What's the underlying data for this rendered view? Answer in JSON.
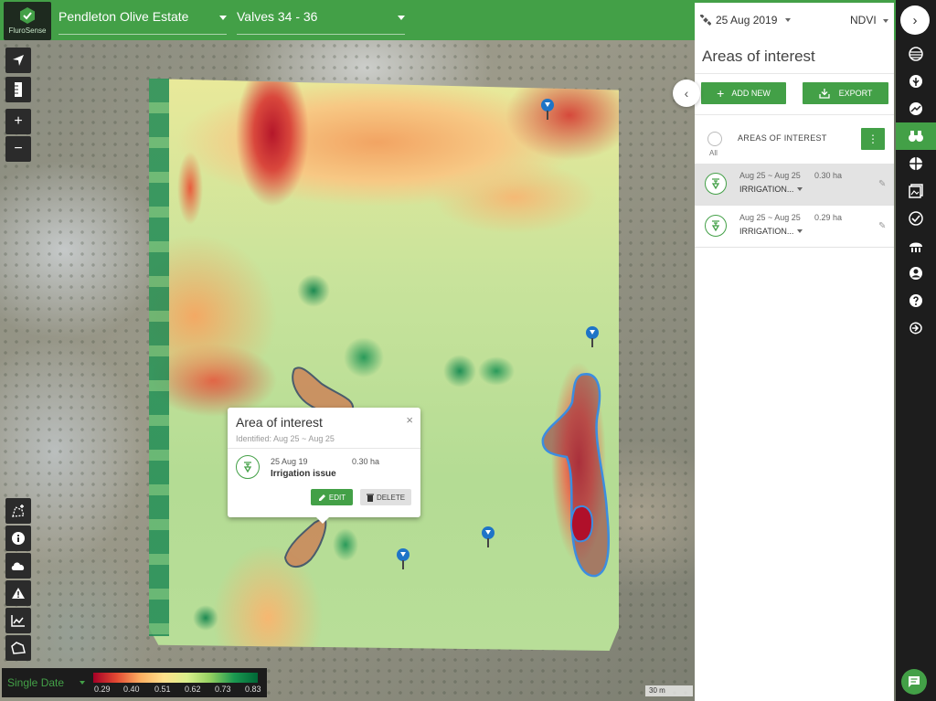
{
  "brand": {
    "logo_text": "FluroSense"
  },
  "topbar": {
    "farm": "Pendleton Olive Estate",
    "field": "Valves 34 - 36"
  },
  "panel": {
    "date": "25 Aug 2019",
    "layer": "NDVI",
    "title": "Areas of interest",
    "add_new_label": "ADD NEW",
    "export_label": "EXPORT",
    "list_header": "AREAS OF INTEREST",
    "select_all_label": "All",
    "items": [
      {
        "dates": "Aug 25 ~ Aug 25",
        "area": "0.30 ha",
        "type": "IRRIGATION...",
        "selected": true
      },
      {
        "dates": "Aug 25 ~ Aug 25",
        "area": "0.29 ha",
        "type": "IRRIGATION...",
        "selected": false
      }
    ]
  },
  "popup": {
    "title": "Area of interest",
    "close": "×",
    "identified": "Identified: Aug 25 ~ Aug 25",
    "date": "25 Aug 19",
    "area": "0.30 ha",
    "issue": "Irrigation issue",
    "edit_label": "EDIT",
    "delete_label": "DELETE"
  },
  "legend": {
    "mode": "Single Date",
    "ticks": [
      "0.29",
      "0.40",
      "0.51",
      "0.62",
      "0.73",
      "0.83"
    ],
    "colors": [
      "#a50026",
      "#e34a33",
      "#fdae61",
      "#fee08b",
      "#d9ef8b",
      "#91cf60",
      "#1a9850",
      "#006837"
    ]
  },
  "scale": {
    "label": "30 m"
  },
  "map_tools": [
    "locate-icon",
    "ruler-icon",
    "zoom-in-icon",
    "zoom-out-icon"
  ],
  "bottom_tools": [
    "draw-polygon-icon",
    "info-icon",
    "weather-icon",
    "warning-icon",
    "chart-icon",
    "field-shape-icon"
  ],
  "sidebar": [
    "layers-icon",
    "crop-icon",
    "analytics-icon",
    "binoculars-icon",
    "zones-icon",
    "reports-icon",
    "checklist-icon",
    "team-icon",
    "account-icon",
    "help-icon",
    "logout-icon"
  ],
  "theme": {
    "accent": "#43a047",
    "dark": "#1d1d1d"
  }
}
